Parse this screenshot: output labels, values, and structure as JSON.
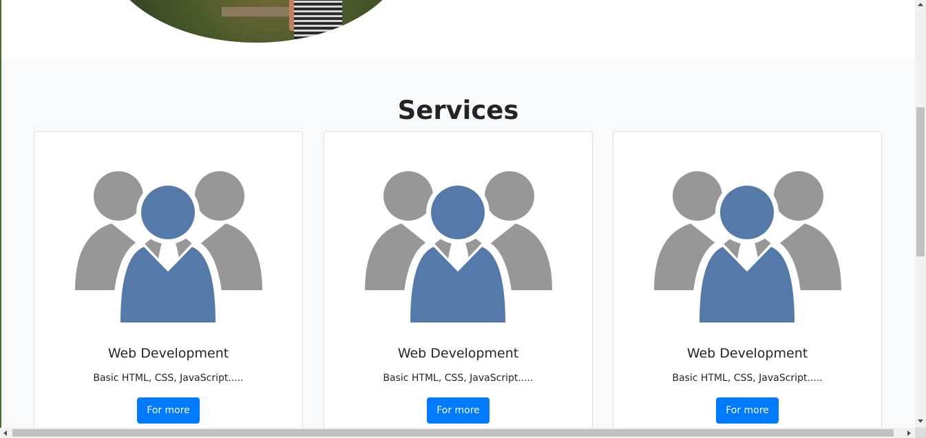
{
  "services": {
    "title": "Services",
    "cards": [
      {
        "icon": "team-icon",
        "title": "Web Development",
        "text": "Basic HTML, CSS, JavaScript.....",
        "button_label": "For more"
      },
      {
        "icon": "team-icon",
        "title": "Web Development",
        "text": "Basic HTML, CSS, JavaScript.....",
        "button_label": "For more"
      },
      {
        "icon": "team-icon",
        "title": "Web Development",
        "text": "Basic HTML, CSS, JavaScript.....",
        "button_label": "For more"
      }
    ]
  },
  "colors": {
    "primary_button": "#007bff",
    "section_background": "#f8f9fa",
    "icon_gray": "#979797",
    "icon_blue": "#5579a8"
  }
}
